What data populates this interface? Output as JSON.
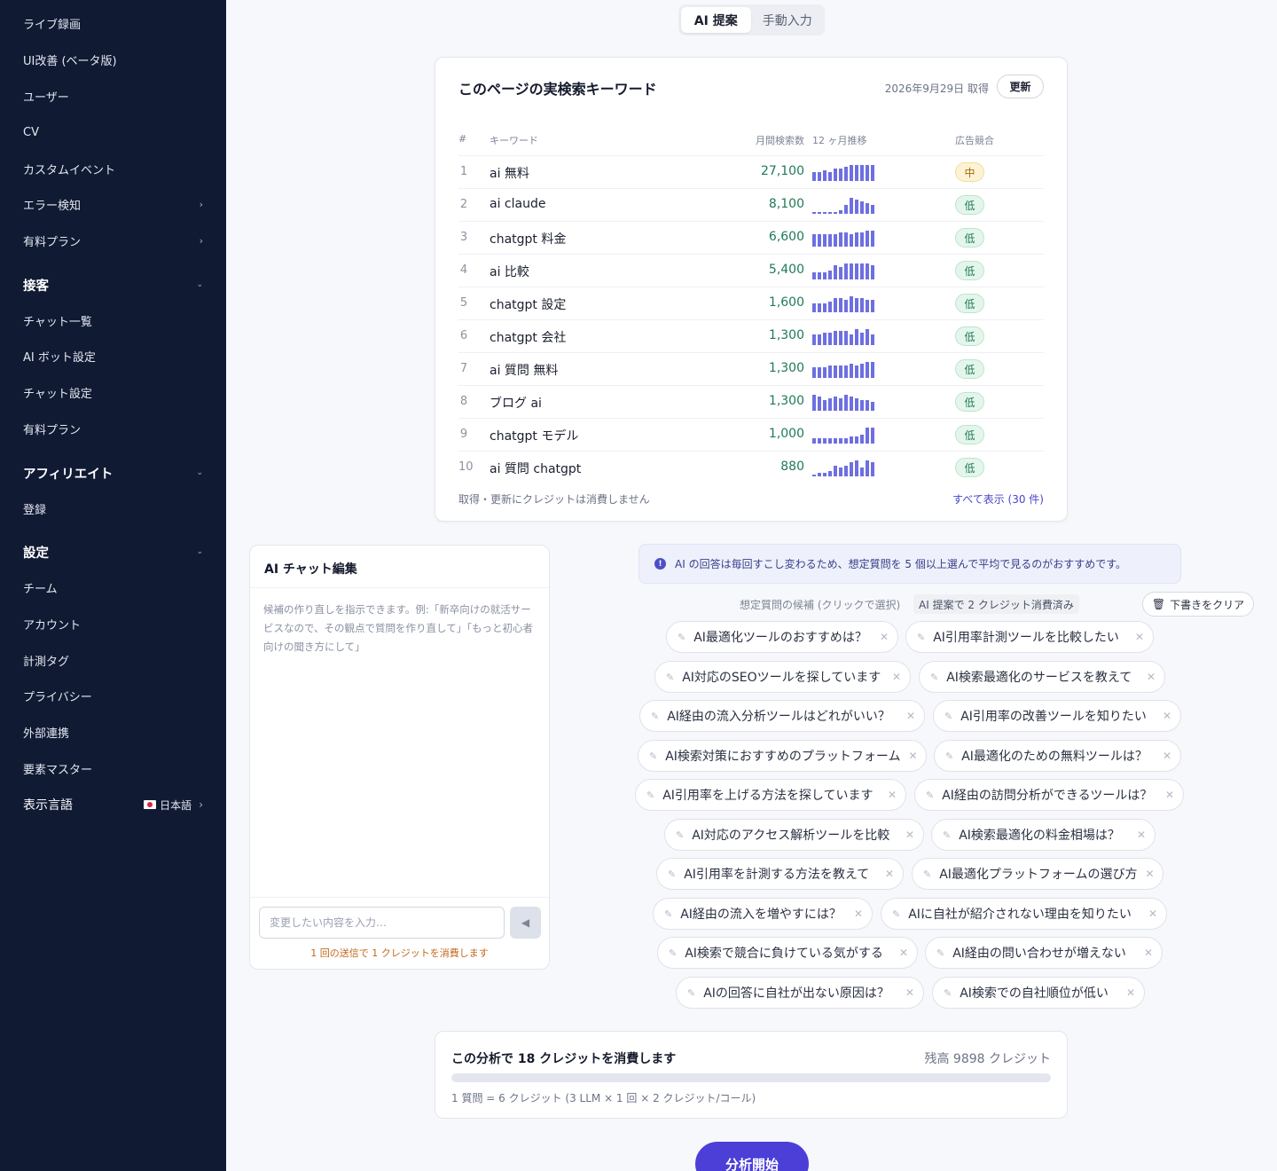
{
  "sidebar": {
    "items": [
      {
        "label": "ライブ録画"
      },
      {
        "label": "UI改善 (ベータ版)"
      },
      {
        "label": "ユーザー"
      },
      {
        "label": "CV"
      },
      {
        "label": "カスタムイベント"
      },
      {
        "label": "エラー検知"
      },
      {
        "label": "有料プラン"
      }
    ],
    "sections": [
      {
        "title": "接客",
        "items": [
          {
            "label": "チャット一覧"
          },
          {
            "label": "AI ボット設定"
          },
          {
            "label": "チャット設定"
          },
          {
            "label": "有料プラン"
          }
        ]
      },
      {
        "title": "アフィリエイト",
        "items": [
          {
            "label": "登録"
          }
        ]
      },
      {
        "title": "設定",
        "items": [
          {
            "label": "チーム"
          },
          {
            "label": "アカウント"
          },
          {
            "label": "計測タグ"
          },
          {
            "label": "プライバシー"
          },
          {
            "label": "外部連携"
          },
          {
            "label": "要素マスター"
          }
        ]
      }
    ],
    "language": {
      "label": "表示言語",
      "value": "日本語"
    }
  },
  "tabs": [
    {
      "label": "AI 提案",
      "active": true
    },
    {
      "label": "手動入力",
      "active": false
    }
  ],
  "keywords": {
    "title": "このページの実検索キーワード",
    "fetched": "2026年9月29日 取得",
    "refresh_label": "更新",
    "columns": {
      "num": "#",
      "keyword": "キーワード",
      "volume": "月間検索数",
      "trend": "12 ヶ月推移",
      "ad": "広告競合"
    },
    "rows": [
      {
        "num": "1",
        "keyword": "ai 無料",
        "volume": "27,100",
        "ad": "中",
        "trend": [
          5,
          5,
          6,
          5,
          7,
          7,
          8,
          9,
          9,
          9,
          9,
          9
        ]
      },
      {
        "num": "2",
        "keyword": "ai claude",
        "volume": "8,100",
        "ad": "低",
        "trend": [
          1,
          1,
          1,
          1,
          1,
          2,
          5,
          9,
          8,
          7,
          6,
          5
        ]
      },
      {
        "num": "3",
        "keyword": "chatgpt 料金",
        "volume": "6,600",
        "ad": "低",
        "trend": [
          7,
          7,
          7,
          7,
          7,
          8,
          8,
          7,
          8,
          8,
          9,
          9
        ]
      },
      {
        "num": "4",
        "keyword": "ai 比較",
        "volume": "5,400",
        "ad": "低",
        "trend": [
          4,
          4,
          4,
          5,
          8,
          7,
          9,
          9,
          9,
          9,
          9,
          8
        ]
      },
      {
        "num": "5",
        "keyword": "chatgpt 設定",
        "volume": "1,600",
        "ad": "低",
        "trend": [
          5,
          5,
          5,
          6,
          8,
          8,
          7,
          9,
          8,
          8,
          7,
          7
        ]
      },
      {
        "num": "6",
        "keyword": "chatgpt 会社",
        "volume": "1,300",
        "ad": "低",
        "trend": [
          6,
          6,
          7,
          7,
          8,
          8,
          8,
          6,
          9,
          7,
          9,
          6
        ]
      },
      {
        "num": "7",
        "keyword": "ai 質問 無料",
        "volume": "1,300",
        "ad": "低",
        "trend": [
          6,
          6,
          6,
          7,
          7,
          7,
          7,
          8,
          7,
          8,
          9,
          9
        ]
      },
      {
        "num": "8",
        "keyword": "ブログ ai",
        "volume": "1,300",
        "ad": "低",
        "trend": [
          9,
          8,
          6,
          7,
          8,
          7,
          9,
          8,
          7,
          6,
          6,
          5
        ]
      },
      {
        "num": "9",
        "keyword": "chatgpt モデル",
        "volume": "1,000",
        "ad": "低",
        "trend": [
          3,
          3,
          3,
          3,
          3,
          3,
          3,
          4,
          4,
          5,
          9,
          9
        ]
      },
      {
        "num": "10",
        "keyword": "ai 質問 chatgpt",
        "volume": "880",
        "ad": "低",
        "trend": [
          1,
          2,
          2,
          3,
          6,
          5,
          6,
          8,
          9,
          5,
          9,
          8
        ]
      }
    ],
    "footer_note": "取得・更新にクレジットは消費しません",
    "show_all": "すべて表示 (30 件)"
  },
  "chat": {
    "title": "AI チャット編集",
    "hint": "候補の作り直しを指示できます。例:「新卒向けの就活サービスなので、その観点で質問を作り直して」「もっと初心者向けの聞き方にして」",
    "placeholder": "変更したい内容を入力…",
    "note": "1 回の送信で 1 クレジットを消費します"
  },
  "info_text": "AI の回答は毎回すこし変わるため、想定質問を 5 個以上選んで平均で見るのがおすすめです。",
  "candidates": {
    "label": "想定質問の候補 (クリックで選択)",
    "used": "AI 提案で 2 クレジット消費済み",
    "clear_label": "下書きをクリア",
    "chips": [
      "AI最適化ツールのおすすめは？",
      "AI引用率計測ツールを比較したい",
      "AI対応のSEOツールを探しています",
      "AI検索最適化のサービスを教えて",
      "AI経由の流入分析ツールはどれがいい？",
      "AI引用率の改善ツールを知りたい",
      "AI検索対策におすすめのプラットフォーム",
      "AI最適化のための無料ツールは？",
      "AI引用率を上げる方法を探しています",
      "AI経由の訪問分析ができるツールは？",
      "AI対応のアクセス解析ツールを比較",
      "AI検索最適化の料金相場は？",
      "AI引用率を計測する方法を教えて",
      "AI最適化プラットフォームの選び方",
      "AI経由の流入を増やすには？",
      "AIに自社が紹介されない理由を知りたい",
      "AI検索で競合に負けている気がする",
      "AI経由の問い合わせが増えない",
      "AIの回答に自社が出ない原因は？",
      "AI検索での自社順位が低い"
    ]
  },
  "credit": {
    "title": "この分析で 18 クレジットを消費します",
    "balance": "残高 9898 クレジット",
    "formula": "1 質問 = 6 クレジット (3 LLM × 1 回 × 2 クレジット/コール)",
    "progress": 0
  },
  "start_label": "分析開始",
  "colors": {
    "sidebar_bg": "#101a33",
    "accent": "#4b3fd8",
    "volume_text": "#1f7a56",
    "spark": "#6e6fe0",
    "ad_mid_bg": "#fdf3d4",
    "ad_low_bg": "#e4f6ec"
  }
}
